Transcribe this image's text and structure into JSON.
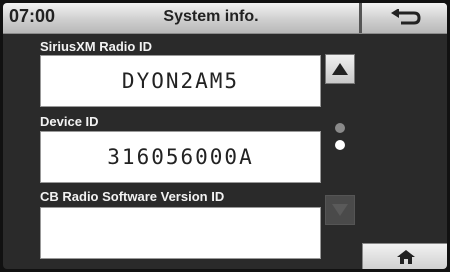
{
  "header": {
    "clock": "07:00",
    "title": "System info."
  },
  "fields": [
    {
      "label": "SiriusXM Radio ID",
      "value": "DYON2AM5"
    },
    {
      "label": "Device ID",
      "value": "316056000A"
    },
    {
      "label": "CB Radio Software Version ID",
      "value": ""
    }
  ],
  "icons": {
    "back": "back-arrow-icon",
    "scroll_up": "triangle-up-icon",
    "scroll_down": "triangle-down-icon",
    "home": "home-icon"
  },
  "page_indicator": {
    "pages": 2,
    "current": 2
  },
  "colors": {
    "background": "#2a2a2a",
    "label_text": "#f2f2f2",
    "field_background": "#ffffff"
  }
}
